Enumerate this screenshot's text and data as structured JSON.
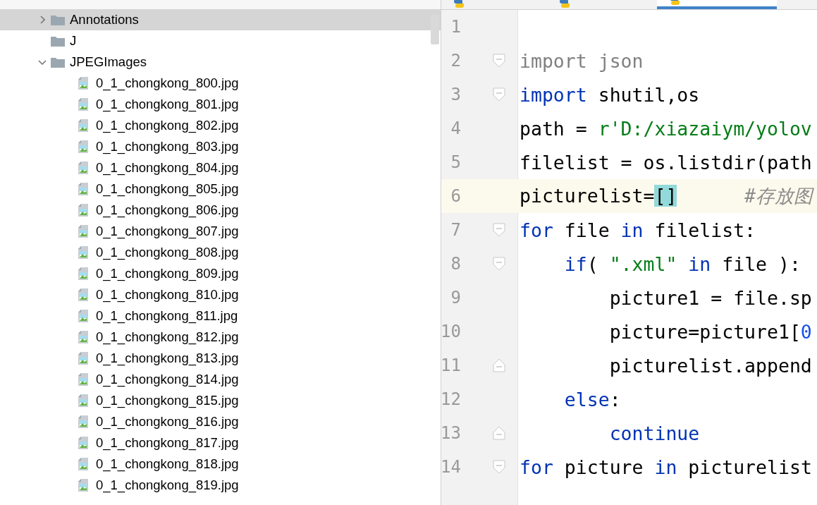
{
  "editor_tabs": [
    {
      "selected": false
    },
    {
      "selected": false
    },
    {
      "selected": true
    }
  ],
  "project_tree": [
    {
      "kind": "folder",
      "label": "Annotations",
      "expanded": false,
      "selected": true
    },
    {
      "kind": "folder",
      "label": "J",
      "selected": false
    },
    {
      "kind": "folder",
      "label": "JPEGImages",
      "expanded": true,
      "selected": false,
      "children": [
        {
          "kind": "image",
          "label": "0_1_chongkong_800.jpg"
        },
        {
          "kind": "image",
          "label": "0_1_chongkong_801.jpg"
        },
        {
          "kind": "image",
          "label": "0_1_chongkong_802.jpg"
        },
        {
          "kind": "image",
          "label": "0_1_chongkong_803.jpg"
        },
        {
          "kind": "image",
          "label": "0_1_chongkong_804.jpg"
        },
        {
          "kind": "image",
          "label": "0_1_chongkong_805.jpg"
        },
        {
          "kind": "image",
          "label": "0_1_chongkong_806.jpg"
        },
        {
          "kind": "image",
          "label": "0_1_chongkong_807.jpg"
        },
        {
          "kind": "image",
          "label": "0_1_chongkong_808.jpg"
        },
        {
          "kind": "image",
          "label": "0_1_chongkong_809.jpg"
        },
        {
          "kind": "image",
          "label": "0_1_chongkong_810.jpg"
        },
        {
          "kind": "image",
          "label": "0_1_chongkong_811.jpg"
        },
        {
          "kind": "image",
          "label": "0_1_chongkong_812.jpg"
        },
        {
          "kind": "image",
          "label": "0_1_chongkong_813.jpg"
        },
        {
          "kind": "image",
          "label": "0_1_chongkong_814.jpg"
        },
        {
          "kind": "image",
          "label": "0_1_chongkong_815.jpg"
        },
        {
          "kind": "image",
          "label": "0_1_chongkong_816.jpg"
        },
        {
          "kind": "image",
          "label": "0_1_chongkong_817.jpg"
        },
        {
          "kind": "image",
          "label": "0_1_chongkong_818.jpg"
        },
        {
          "kind": "image",
          "label": "0_1_chongkong_819.jpg"
        }
      ]
    }
  ],
  "code_lines": [
    {
      "number": "1",
      "fold_start": false,
      "fold_end": false,
      "current": false
    },
    {
      "number": "2",
      "fold_start": true,
      "fold_end": false,
      "current": false,
      "tokens": [
        {
          "kind": "kw-grey",
          "text": "import json"
        }
      ]
    },
    {
      "number": "3",
      "fold_start": true,
      "fold_end": false,
      "current": false,
      "tokens": [
        {
          "kind": "kw",
          "text": "import"
        },
        {
          "kind": "plain",
          "text": " shutil,os"
        }
      ]
    },
    {
      "number": "4",
      "fold_start": false,
      "fold_end": false,
      "current": false,
      "tokens": [
        {
          "kind": "plain",
          "text": "path = "
        },
        {
          "kind": "str",
          "text": "r'D:/xiazaiym/yolov"
        }
      ]
    },
    {
      "number": "5",
      "fold_start": false,
      "fold_end": false,
      "current": false,
      "tokens": [
        {
          "kind": "plain",
          "text": "filelist = os.listdir(path"
        }
      ]
    },
    {
      "number": "6",
      "fold_start": false,
      "fold_end": false,
      "current": true,
      "tokens": [
        {
          "kind": "plain",
          "text": "picturelist="
        },
        {
          "kind": "bracket",
          "text": "[]"
        },
        {
          "kind": "comment",
          "text": "      #存放图"
        }
      ]
    },
    {
      "number": "7",
      "fold_start": true,
      "fold_end": false,
      "current": false,
      "tokens": [
        {
          "kind": "kw",
          "text": "for"
        },
        {
          "kind": "plain",
          "text": " file "
        },
        {
          "kind": "kw",
          "text": "in"
        },
        {
          "kind": "plain",
          "text": " filelist:"
        }
      ]
    },
    {
      "number": "8",
      "fold_start": true,
      "fold_end": false,
      "current": false,
      "tokens": [
        {
          "kind": "kw",
          "text": "    if"
        },
        {
          "kind": "plain",
          "text": "( "
        },
        {
          "kind": "str",
          "text": "\".xml\""
        },
        {
          "kind": "kw",
          "text": " in"
        },
        {
          "kind": "plain",
          "text": " file ):"
        }
      ]
    },
    {
      "number": "9",
      "fold_start": false,
      "fold_end": false,
      "current": false,
      "tokens": [
        {
          "kind": "plain",
          "text": "        picture1 = file.sp"
        }
      ]
    },
    {
      "number": "10",
      "fold_start": false,
      "fold_end": false,
      "current": false,
      "tokens": [
        {
          "kind": "plain",
          "text": "        picture=picture1["
        },
        {
          "kind": "num",
          "text": "0"
        }
      ]
    },
    {
      "number": "11",
      "fold_start": false,
      "fold_end": true,
      "current": false,
      "tokens": [
        {
          "kind": "plain",
          "text": "        picturelist.append"
        }
      ]
    },
    {
      "number": "12",
      "fold_start": false,
      "fold_end": false,
      "current": false,
      "tokens": [
        {
          "kind": "kw",
          "text": "    else"
        },
        {
          "kind": "plain",
          "text": ":"
        }
      ]
    },
    {
      "number": "13",
      "fold_start": false,
      "fold_end": true,
      "current": false,
      "tokens": [
        {
          "kind": "kw",
          "text": "        continue"
        }
      ]
    },
    {
      "number": "14",
      "fold_start": true,
      "fold_end": false,
      "current": false,
      "tokens": [
        {
          "kind": "kw",
          "text": "for"
        },
        {
          "kind": "plain",
          "text": " picture "
        },
        {
          "kind": "kw",
          "text": "in"
        },
        {
          "kind": "plain",
          "text": " picturelist"
        }
      ]
    }
  ]
}
